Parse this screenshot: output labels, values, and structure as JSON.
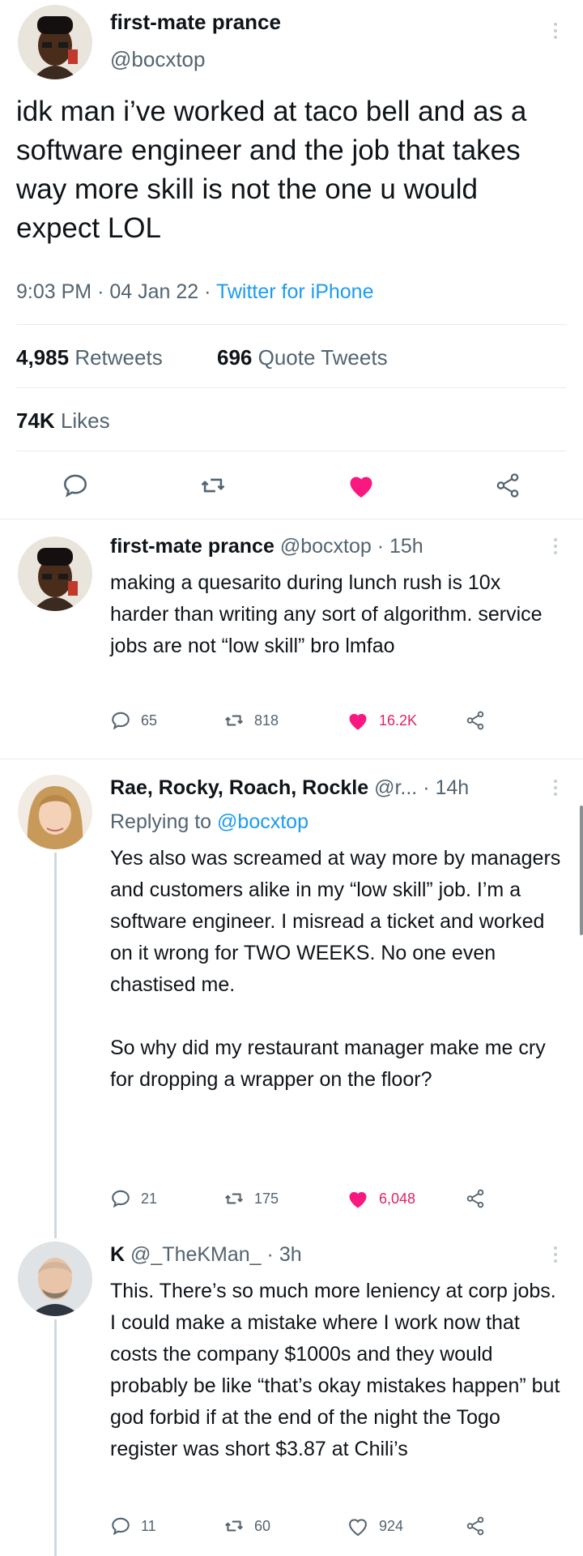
{
  "main_tweet": {
    "author_name": "first-mate prance",
    "author_handle": "@bocxtop",
    "text": "idk man i’ve worked at taco bell and as a software engineer and the job that takes way more skill is not the one u would expect LOL",
    "time": "9:03 PM",
    "date": "04 Jan 22",
    "source": "Twitter for iPhone",
    "retweets_count": "4,985",
    "retweets_label": "Retweets",
    "quotes_count": "696",
    "quotes_label": "Quote Tweets",
    "likes_count": "74K",
    "likes_label": "Likes"
  },
  "replies": [
    {
      "author_name": "first-mate prance",
      "author_handle": "@bocxtop",
      "age": "15h",
      "replying_to_label": "",
      "replying_to_handle": "",
      "text": "making a quesarito during lunch rush is 10x harder than writing any sort of algorithm. service jobs are not “low skill” bro lmfao",
      "reply_count": "65",
      "retweet_count": "818",
      "like_count": "16.2K",
      "liked": true
    },
    {
      "author_name": "Rae, Rocky, Roach, Rockle",
      "author_handle": "@r...",
      "age": "14h",
      "replying_to_label": "Replying to",
      "replying_to_handle": "@bocxtop",
      "text": "Yes also was screamed at way more by managers and customers alike in my “low skill” job. I’m a software engineer. I misread a ticket and worked on it wrong for TWO WEEKS. No one even chastised me.\n\nSo why did my restaurant manager make me cry for dropping a wrapper on the floor?",
      "reply_count": "21",
      "retweet_count": "175",
      "like_count": "6,048",
      "liked": true
    },
    {
      "author_name": "K",
      "author_handle": "@_TheKMan_",
      "age": "3h",
      "replying_to_label": "",
      "replying_to_handle": "",
      "text": "This. There’s so much more leniency at corp jobs. I could make a mistake where I work now that costs the company $1000s and they would probably be like “that’s okay mistakes happen” but god forbid if at the end of the night the Togo register was short $3.87 at Chili’s",
      "reply_count": "11",
      "retweet_count": "60",
      "like_count": "924",
      "liked": false
    }
  ],
  "colors": {
    "accent": "#1d9bf0",
    "like": "#f91880",
    "muted_text": "#536471",
    "text": "#0f1419"
  },
  "icons": [
    "reply-icon",
    "retweet-icon",
    "heart-icon",
    "share-icon",
    "more-icon"
  ]
}
